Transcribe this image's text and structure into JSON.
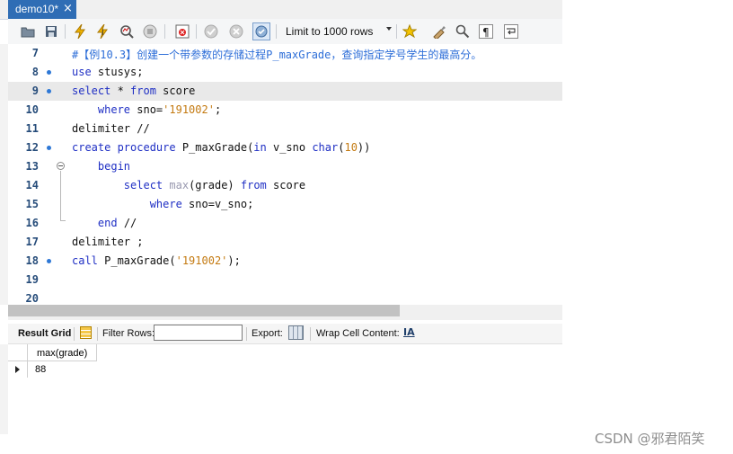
{
  "tab": {
    "title": "demo10*",
    "close": "×"
  },
  "toolbar": {
    "icons": [
      "open-folder-icon",
      "save-icon",
      "execute-icon",
      "execute-current-icon",
      "explain-icon",
      "stop-icon",
      "toggle-error-icon",
      "commit-icon",
      "rollback-icon",
      "autocommit-icon",
      "bookmark-star-icon",
      "beautify-icon",
      "find-icon",
      "invisible-chars-icon",
      "word-wrap-icon"
    ],
    "limit_label": "Limit to 1000 rows"
  },
  "editor": {
    "lines": [
      {
        "n": "7",
        "bullet": false,
        "code": "#【例10.3】创建一个带参数的存储过程P_maxGrade，查询指定学号学生的最高分。"
      },
      {
        "n": "8",
        "bullet": true,
        "code": "use stusys;"
      },
      {
        "n": "9",
        "bullet": true,
        "code": "select * from score",
        "highlight": true
      },
      {
        "n": "10",
        "bullet": false,
        "code": "    where sno='191002';"
      },
      {
        "n": "11",
        "bullet": false,
        "code": "delimiter //"
      },
      {
        "n": "12",
        "bullet": true,
        "code": "create procedure P_maxGrade(in v_sno char(10))"
      },
      {
        "n": "13",
        "bullet": false,
        "code": "    begin"
      },
      {
        "n": "14",
        "bullet": false,
        "code": "        select max(grade) from score"
      },
      {
        "n": "15",
        "bullet": false,
        "code": "            where sno=v_sno;"
      },
      {
        "n": "16",
        "bullet": false,
        "code": "    end //"
      },
      {
        "n": "17",
        "bullet": false,
        "code": "delimiter ;"
      },
      {
        "n": "18",
        "bullet": true,
        "code": "call P_maxGrade('191002');"
      },
      {
        "n": "19",
        "bullet": false,
        "code": ""
      },
      {
        "n": "20",
        "bullet": false,
        "code": ""
      }
    ]
  },
  "result_bar": {
    "result_grid": "Result Grid",
    "filter_rows": "Filter Rows:",
    "filter_value": "",
    "export": "Export:",
    "wrap_cell": "Wrap Cell Content:",
    "wrap_icon_text": "IA"
  },
  "result_grid": {
    "columns": [
      "max(grade)"
    ],
    "rows": [
      [
        "88"
      ]
    ]
  },
  "watermark": "CSDN @邪君陌笑"
}
